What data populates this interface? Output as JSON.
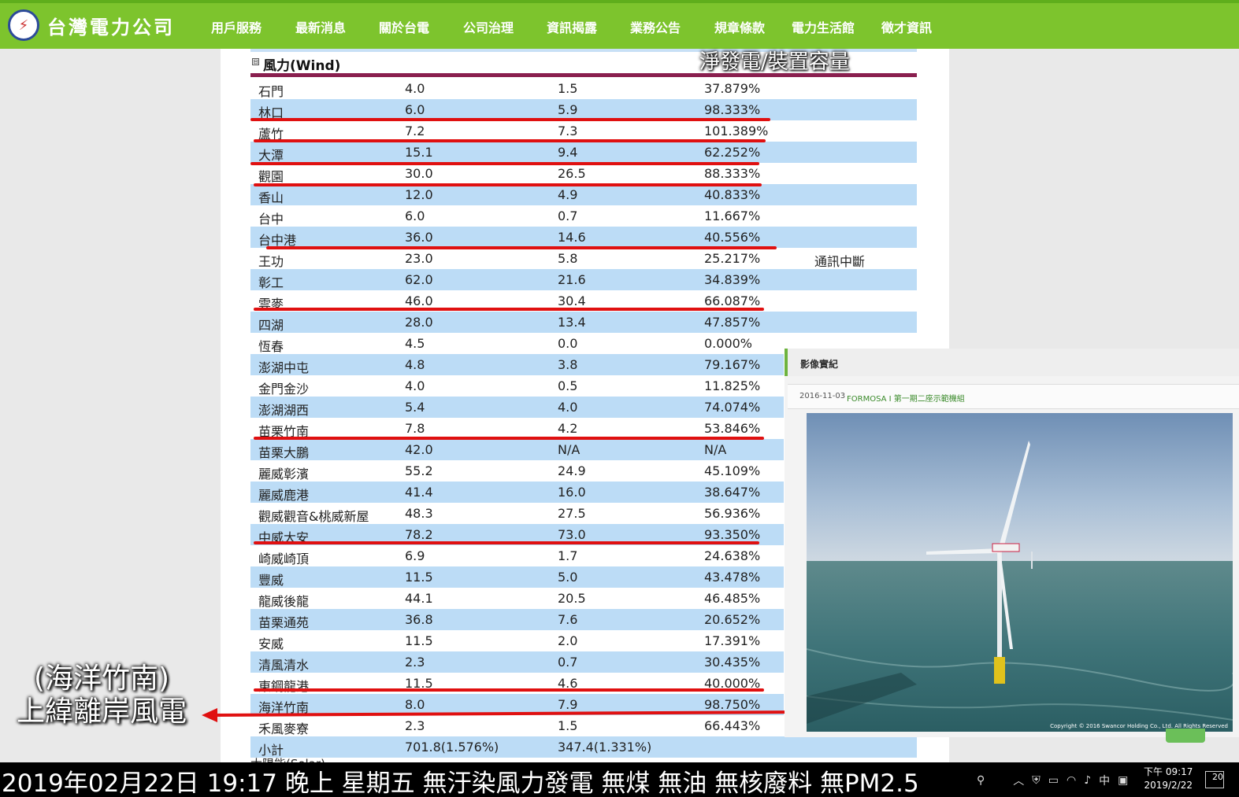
{
  "logo": {
    "text": "台灣電力公司",
    "icon": "taipower-logo-icon"
  },
  "nav": {
    "items": [
      "用戶服務",
      "最新消息",
      "關於台電",
      "公司治理",
      "資訊揭露",
      "業務公告",
      "規章條款",
      "電力生活館",
      "徵才資訊"
    ]
  },
  "section": {
    "collapse_symbol": "⊟",
    "title": "風力(Wind)",
    "overlay_caption": "淨發電/裝置容量"
  },
  "table": {
    "rows": [
      {
        "name": "石門",
        "capacity": "4.0",
        "net": "1.5",
        "ratio": "37.879%",
        "note": ""
      },
      {
        "name": "林口",
        "capacity": "6.0",
        "net": "5.9",
        "ratio": "98.333%",
        "note": ""
      },
      {
        "name": "蘆竹",
        "capacity": "7.2",
        "net": "7.3",
        "ratio": "101.389%",
        "note": ""
      },
      {
        "name": "大潭",
        "capacity": "15.1",
        "net": "9.4",
        "ratio": "62.252%",
        "note": ""
      },
      {
        "name": "觀園",
        "capacity": "30.0",
        "net": "26.5",
        "ratio": "88.333%",
        "note": ""
      },
      {
        "name": "香山",
        "capacity": "12.0",
        "net": "4.9",
        "ratio": "40.833%",
        "note": ""
      },
      {
        "name": "台中",
        "capacity": "6.0",
        "net": "0.7",
        "ratio": "11.667%",
        "note": ""
      },
      {
        "name": "台中港",
        "capacity": "36.0",
        "net": "14.6",
        "ratio": "40.556%",
        "note": ""
      },
      {
        "name": "王功",
        "capacity": "23.0",
        "net": "5.8",
        "ratio": "25.217%",
        "note": "通訊中斷"
      },
      {
        "name": "彰工",
        "capacity": "62.0",
        "net": "21.6",
        "ratio": "34.839%",
        "note": ""
      },
      {
        "name": "雲麥",
        "capacity": "46.0",
        "net": "30.4",
        "ratio": "66.087%",
        "note": ""
      },
      {
        "name": "四湖",
        "capacity": "28.0",
        "net": "13.4",
        "ratio": "47.857%",
        "note": ""
      },
      {
        "name": "恆春",
        "capacity": "4.5",
        "net": "0.0",
        "ratio": "0.000%",
        "note": ""
      },
      {
        "name": "澎湖中屯",
        "capacity": "4.8",
        "net": "3.8",
        "ratio": "79.167%",
        "note": ""
      },
      {
        "name": "金門金沙",
        "capacity": "4.0",
        "net": "0.5",
        "ratio": "11.825%",
        "note": ""
      },
      {
        "name": "澎湖湖西",
        "capacity": "5.4",
        "net": "4.0",
        "ratio": "74.074%",
        "note": ""
      },
      {
        "name": "苗栗竹南",
        "capacity": "7.8",
        "net": "4.2",
        "ratio": "53.846%",
        "note": ""
      },
      {
        "name": "苗栗大鵬",
        "capacity": "42.0",
        "net": "N/A",
        "ratio": "N/A",
        "note": ""
      },
      {
        "name": "麗威彰濱",
        "capacity": "55.2",
        "net": "24.9",
        "ratio": "45.109%",
        "note": ""
      },
      {
        "name": "麗威鹿港",
        "capacity": "41.4",
        "net": "16.0",
        "ratio": "38.647%",
        "note": ""
      },
      {
        "name": "觀威觀音&桃威新屋",
        "capacity": "48.3",
        "net": "27.5",
        "ratio": "56.936%",
        "note": ""
      },
      {
        "name": "中威大安",
        "capacity": "78.2",
        "net": "73.0",
        "ratio": "93.350%",
        "note": ""
      },
      {
        "name": "崎威崎頂",
        "capacity": "6.9",
        "net": "1.7",
        "ratio": "24.638%",
        "note": ""
      },
      {
        "name": "豐威",
        "capacity": "11.5",
        "net": "5.0",
        "ratio": "43.478%",
        "note": ""
      },
      {
        "name": "龍威後龍",
        "capacity": "44.1",
        "net": "20.5",
        "ratio": "46.485%",
        "note": ""
      },
      {
        "name": "苗栗通苑",
        "capacity": "36.8",
        "net": "7.6",
        "ratio": "20.652%",
        "note": ""
      },
      {
        "name": "安威",
        "capacity": "11.5",
        "net": "2.0",
        "ratio": "17.391%",
        "note": ""
      },
      {
        "name": "清風清水",
        "capacity": "2.3",
        "net": "0.7",
        "ratio": "30.435%",
        "note": ""
      },
      {
        "name": "東鋼龍港",
        "capacity": "11.5",
        "net": "4.6",
        "ratio": "40.000%",
        "note": ""
      },
      {
        "name": "海洋竹南",
        "capacity": "8.0",
        "net": "7.9",
        "ratio": "98.750%",
        "note": ""
      },
      {
        "name": "禾風麥寮",
        "capacity": "2.3",
        "net": "1.5",
        "ratio": "66.443%",
        "note": ""
      },
      {
        "name": "小計",
        "capacity": "701.8(1.576%)",
        "net": "347.4(1.331%)",
        "ratio": "",
        "note": ""
      }
    ]
  },
  "image_card": {
    "title": "影像實紀",
    "date": "2016-11-03",
    "caption": "FORMOSA I 第一期二座示範機組",
    "copyright": "Copyright © 2016 Swancor Holding Co., Ltd. All Rights Reserved"
  },
  "annotation_left": {
    "line1": "(海洋竹南)",
    "line2": "上緯離岸風電"
  },
  "next_row_partial": "太陽能(Solar)",
  "date_caption": "2019年02月22日 19:17 晚上 星期五  無汙染風力發電 無煤 無油 無核廢料 無PM2.5",
  "taskbar": {
    "tray_icons": [
      "person-icon",
      "chevron-up-icon",
      "shield-icon",
      "battery-icon",
      "wifi-icon",
      "volume-icon"
    ],
    "ime": "中",
    "time": "下午 09:17",
    "date": "2019/2/22",
    "notifications": "20"
  },
  "colors": {
    "nav_green": "#7dc42d",
    "row_blue": "#bcdcf6",
    "rule_maroon": "#8a1f4f",
    "annotation_red": "#e01010"
  }
}
